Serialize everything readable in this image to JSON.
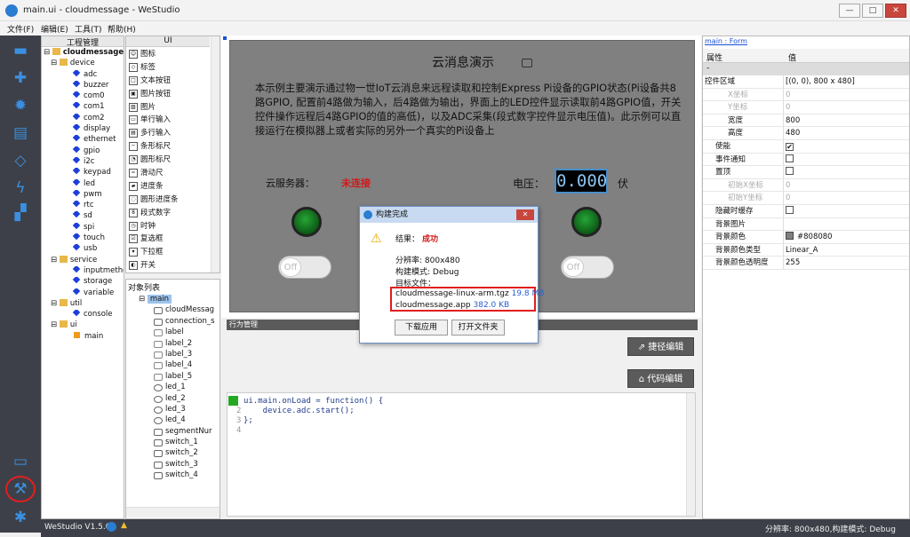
{
  "window": {
    "title": "main.ui - cloudmessage - WeStudio",
    "controls": [
      "—",
      "□",
      "✕"
    ]
  },
  "menu": [
    "文件(F)",
    "编辑(E)",
    "工具(T)",
    "帮助(H)"
  ],
  "sidebar_icons": [
    "folder-icon",
    "plus-icon",
    "gear-icon",
    "document-icon",
    "gem-icon",
    "lightning-icon",
    "network-icon",
    "monitor-icon",
    "wrench-icon",
    "bug-icon"
  ],
  "project": {
    "header": "工程管理",
    "root": "cloudmessage",
    "folders": [
      {
        "name": "device",
        "items": [
          "adc",
          "buzzer",
          "com0",
          "com1",
          "com2",
          "display",
          "ethernet",
          "gpio",
          "i2c",
          "keypad",
          "led",
          "pwm",
          "rtc",
          "sd",
          "spi",
          "touch",
          "usb"
        ]
      },
      {
        "name": "service",
        "items": [
          "inputmetho",
          "storage",
          "variable"
        ]
      },
      {
        "name": "util",
        "items": [
          "console"
        ]
      },
      {
        "name": "ui",
        "items": [
          "main"
        ]
      }
    ]
  },
  "controls_panel": {
    "header": "UI",
    "items": [
      "图标",
      "标签",
      "文本按钮",
      "图片按钮",
      "图片",
      "单行输入",
      "多行输入",
      "条形标尺",
      "圆形标尺",
      "滑动尺",
      "进度条",
      "圆形进度条",
      "段式数字",
      "时钟",
      "复选框",
      "下拉框",
      "开关"
    ]
  },
  "objects_panel": {
    "header": "对象列表",
    "root": "main",
    "items": [
      "cloudMessag",
      "connection_s",
      "label",
      "label_2",
      "label_3",
      "label_4",
      "label_5",
      "led_1",
      "led_2",
      "led_3",
      "led_4",
      "segmentNur",
      "switch_1",
      "switch_2",
      "switch_3",
      "switch_4"
    ]
  },
  "demo": {
    "title": "云消息演示",
    "description": "本示例主要演示通过物一世IoT云消息来远程读取和控制Express Pi设备的GPIO状态(Pi设备共8路GPIO, 配置前4路做为输入，后4路做为输出，界面上的LED控件显示读取前4路GPIO值，开关控件操作远程后4路GPIO的值的高低)，以及ADC采集(段式数字控件显示电压值)。此示例可以直接运行在模拟器上或者实际的另外一个真实的Pi设备上",
    "server_label": "云服务器：",
    "server_status": "未连接",
    "voltage_label": "电压：",
    "voltage_value": "0.000",
    "voltage_unit": "伏",
    "switch_text": "Off"
  },
  "behavior": {
    "header": "行为管理",
    "quick_edit": "捷径编辑",
    "code_edit": "代码编辑"
  },
  "code": {
    "lines": [
      "ui.main.onLoad = function() {",
      "    device.adc.start();",
      "};",
      ""
    ],
    "line_numbers": [
      "1",
      "2",
      "3",
      "4"
    ]
  },
  "properties": {
    "header_link": "main : Form",
    "col_name": "属性",
    "col_value": "值",
    "group": "-",
    "rows": [
      {
        "name": "控件区域",
        "value": "[(0, 0), 800 x 480]",
        "kind": "text",
        "expand": "⊟"
      },
      {
        "name": "X坐标",
        "value": "0",
        "kind": "disabled"
      },
      {
        "name": "Y坐标",
        "value": "0",
        "kind": "disabled"
      },
      {
        "name": "宽度",
        "value": "800",
        "kind": "text"
      },
      {
        "name": "高度",
        "value": "480",
        "kind": "text"
      },
      {
        "name": "使能",
        "value": "✔",
        "kind": "check"
      },
      {
        "name": "事件通知",
        "value": "",
        "kind": "check"
      },
      {
        "name": "置顶",
        "value": "",
        "kind": "check"
      },
      {
        "name": "初始X坐标",
        "value": "0",
        "kind": "disabled"
      },
      {
        "name": "初始Y坐标",
        "value": "0",
        "kind": "disabled"
      },
      {
        "name": "隐藏时缓存",
        "value": "",
        "kind": "check"
      },
      {
        "name": "背景图片",
        "value": "",
        "kind": "text"
      },
      {
        "name": "背景颜色",
        "value": "#808080",
        "kind": "color"
      },
      {
        "name": "背景颜色类型",
        "value": "Linear_A",
        "kind": "text"
      },
      {
        "name": "背景颜色透明度",
        "value": "255",
        "kind": "text"
      }
    ]
  },
  "dialog": {
    "title": "构建完成",
    "result_label": "结果：",
    "result_value": "成功",
    "resolution": "分辨率: 800x480",
    "build_mode": "构建模式: Debug",
    "target_label": "目标文件：",
    "files": [
      {
        "name": "cloudmessage-linux-arm.tgz",
        "size": "19.8 MB"
      },
      {
        "name": "cloudmessage.app",
        "size": "382.0 KB"
      }
    ],
    "btn_download": "下载应用",
    "btn_open_folder": "打开文件夹"
  },
  "status": {
    "version": "WeStudio V1.5.0",
    "right": "分辨率: 800x480,构建模式: Debug"
  },
  "colors": {
    "sidebar": "#3d4048",
    "accent": "#2a7dd0",
    "error_red": "#d01b1b",
    "canvas_bg": "#808080",
    "highlight_box": "#e21d1d"
  }
}
